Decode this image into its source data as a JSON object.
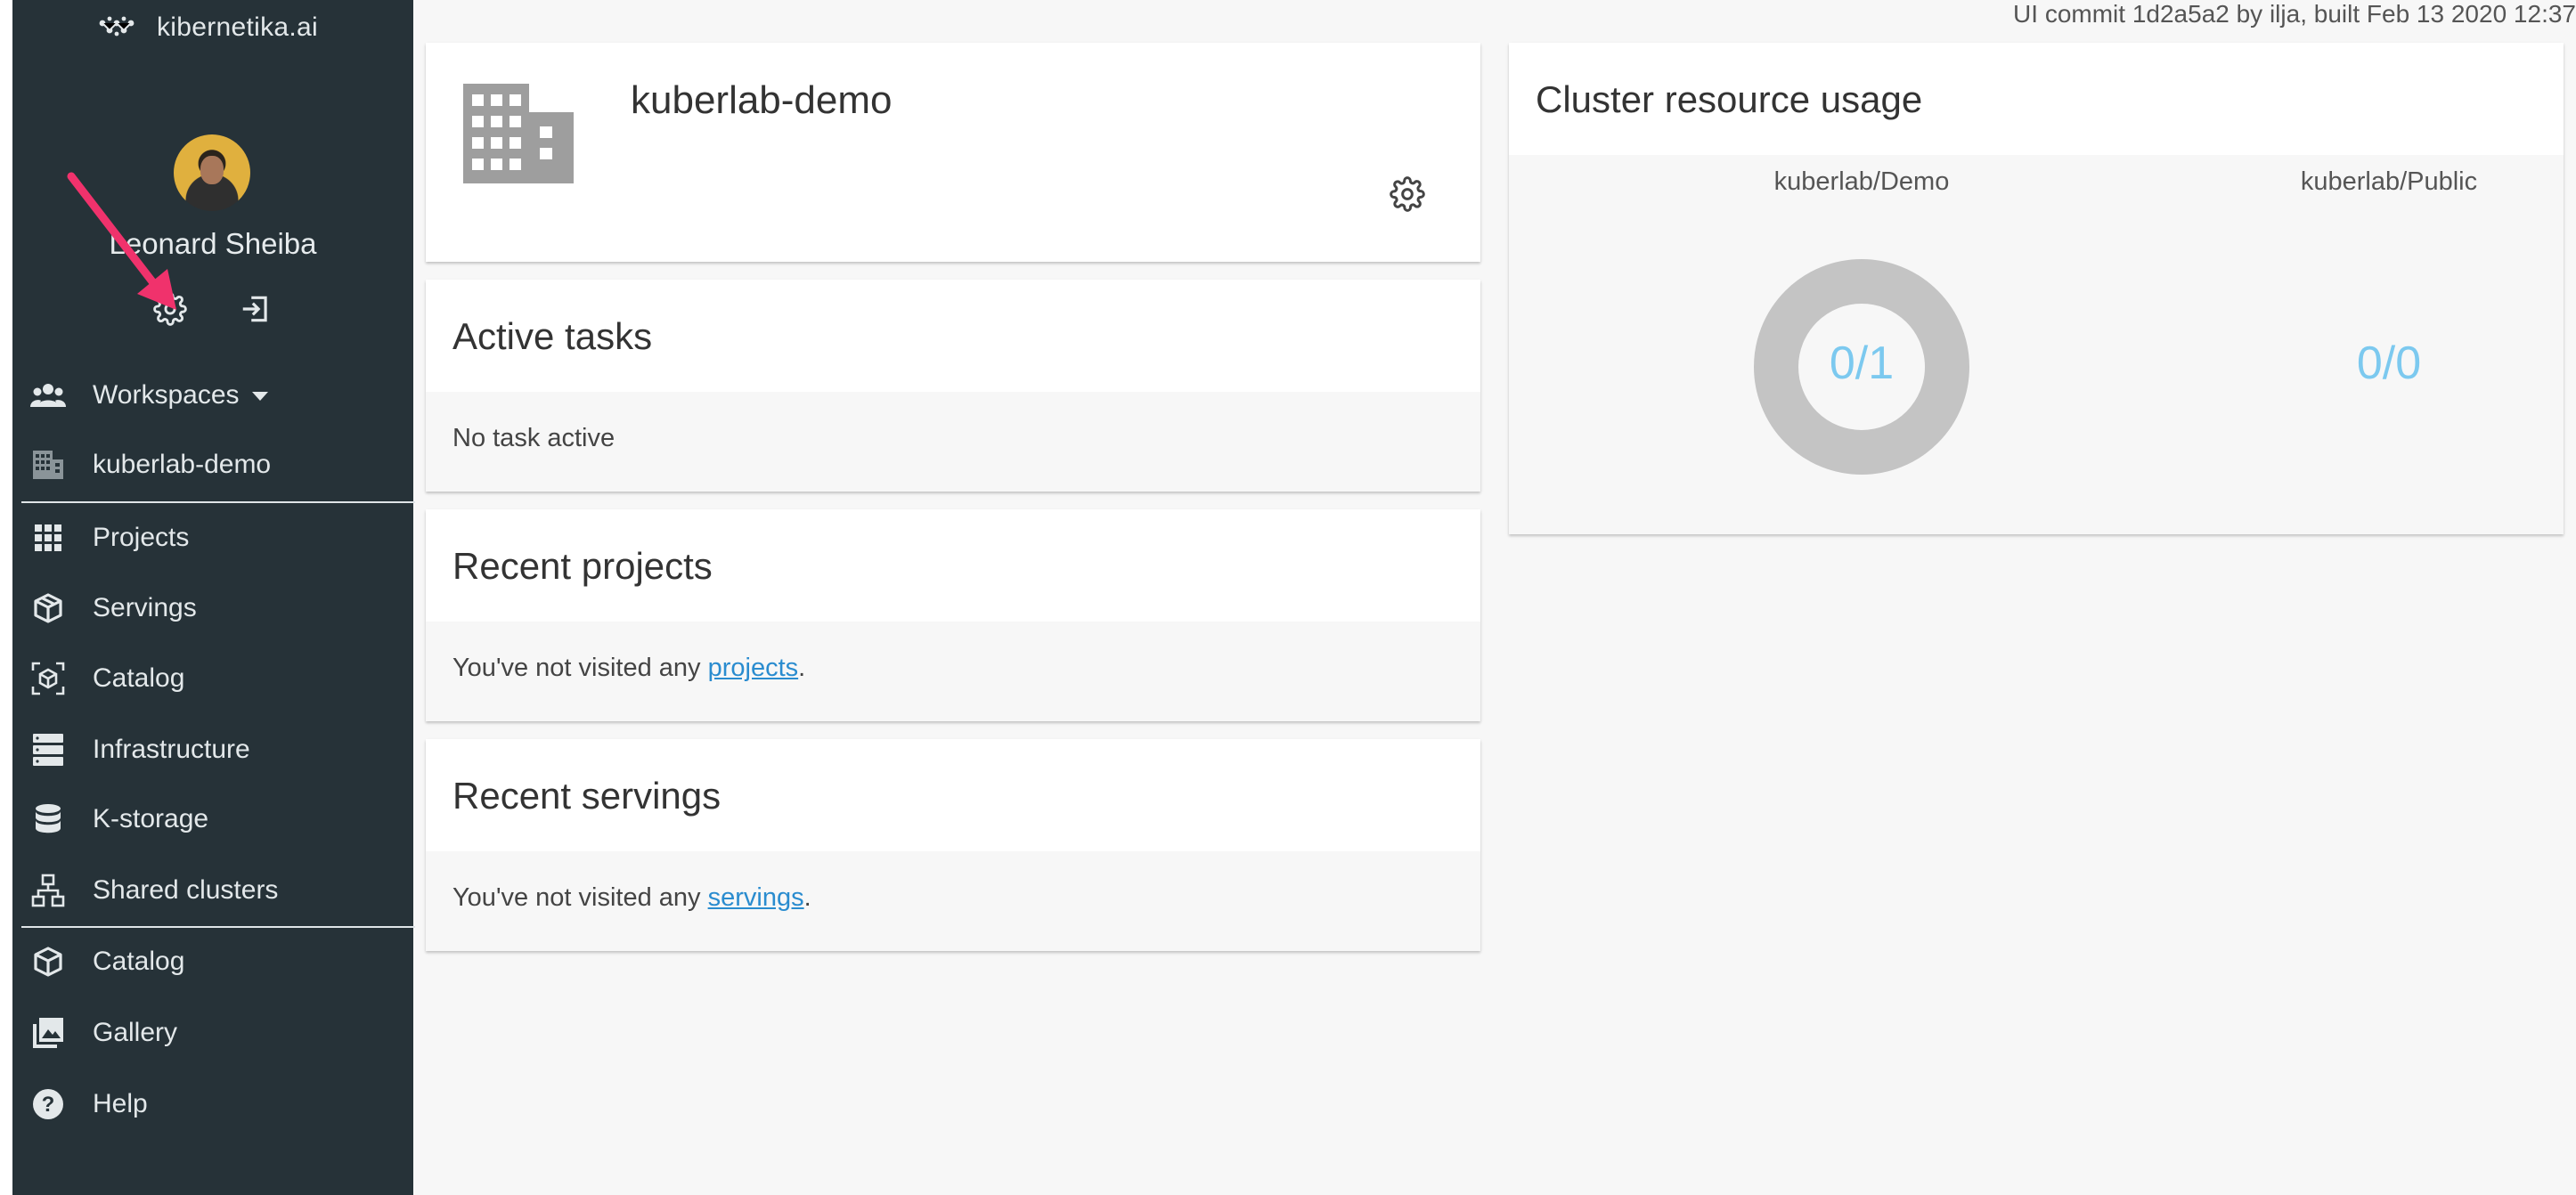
{
  "brand": {
    "name": "kibernetika.ai"
  },
  "user": {
    "name": "Leonard Sheiba"
  },
  "build_info": "UI commit 1d2a5a2 by ilja, built Feb 13 2020 12:37",
  "sidebar": {
    "workspaces_label": "Workspaces",
    "workspace_name": "kuberlab-demo",
    "items": [
      {
        "label": "Projects",
        "icon": "grid-icon"
      },
      {
        "label": "Servings",
        "icon": "cube-open-icon"
      },
      {
        "label": "Catalog",
        "icon": "scan-cube-icon"
      },
      {
        "label": "Infrastructure",
        "icon": "server-icon"
      },
      {
        "label": "K-storage",
        "icon": "database-icon"
      },
      {
        "label": "Shared clusters",
        "icon": "network-icon"
      }
    ],
    "bottom_items": [
      {
        "label": "Catalog",
        "icon": "cube-icon"
      },
      {
        "label": "Gallery",
        "icon": "gallery-icon"
      },
      {
        "label": "Help",
        "icon": "help-icon"
      }
    ]
  },
  "workspace_card": {
    "title": "kuberlab-demo"
  },
  "active_tasks": {
    "title": "Active tasks",
    "body": "No task active"
  },
  "recent_projects": {
    "title": "Recent projects",
    "prefix": "You've not visited any ",
    "link": "projects",
    "suffix": "."
  },
  "recent_servings": {
    "title": "Recent servings",
    "prefix": "You've not visited any ",
    "link": "servings",
    "suffix": "."
  },
  "cluster_usage": {
    "title": "Cluster resource usage",
    "clusters": [
      {
        "name": "kuberlab/Demo",
        "value": "0/1",
        "used": 0,
        "total": 1
      },
      {
        "name": "kuberlab/Public",
        "value": "0/0",
        "used": 0,
        "total": 0
      }
    ]
  },
  "colors": {
    "sidebar": "#263238",
    "accent": "#7cc9ef",
    "link": "#2a8ccf",
    "arrow": "#f0326c"
  }
}
